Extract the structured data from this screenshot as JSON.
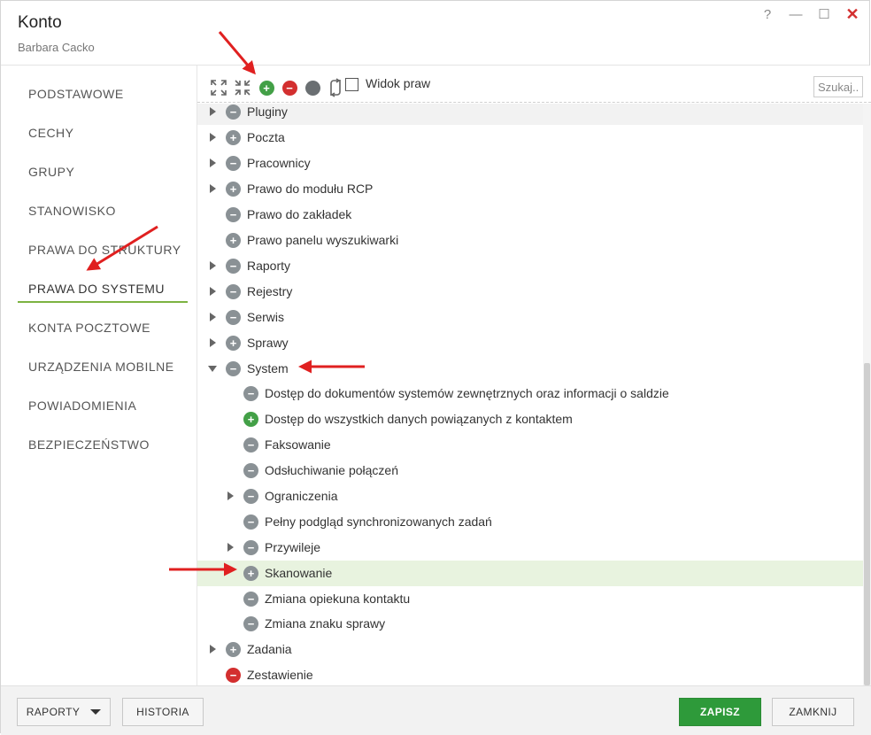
{
  "window": {
    "title": "Konto",
    "subtitle": "Barbara Cacko",
    "controls": {
      "help": "?",
      "minimize": "—",
      "maximize": "☐",
      "close": "✕"
    }
  },
  "sidebar": {
    "items": [
      {
        "label": "PODSTAWOWE",
        "active": false
      },
      {
        "label": "CECHY",
        "active": false
      },
      {
        "label": "GRUPY",
        "active": false
      },
      {
        "label": "STANOWISKO",
        "active": false
      },
      {
        "label": "PRAWA DO STRUKTURY",
        "active": false
      },
      {
        "label": "PRAWA DO SYSTEMU",
        "active": true
      },
      {
        "label": "KONTA POCZTOWE",
        "active": false
      },
      {
        "label": "URZĄDZENIA MOBILNE",
        "active": false
      },
      {
        "label": "POWIADOMIENIA",
        "active": false
      },
      {
        "label": "BEZPIECZEŃSTWO",
        "active": false
      }
    ]
  },
  "toolbar": {
    "expand_icon": "expand-all-icon",
    "collapse_icon": "collapse-all-icon",
    "grant_icon": "plus-circle-icon",
    "deny_icon": "minus-circle-icon",
    "inherit_icon": "gray-circle-icon",
    "toggle_icon": "swap-icon",
    "widok_label": "Widok praw",
    "search_placeholder": "Szukaj..."
  },
  "tree": [
    {
      "label": "Pluginy",
      "state": "gray-minus",
      "expander": "right",
      "level": 0
    },
    {
      "label": "Poczta",
      "state": "gray-plus",
      "expander": "right",
      "level": 0
    },
    {
      "label": "Pracownicy",
      "state": "gray-minus",
      "expander": "right",
      "level": 0
    },
    {
      "label": "Prawo do modułu RCP",
      "state": "gray-plus",
      "expander": "right",
      "level": 0
    },
    {
      "label": "Prawo do zakładek",
      "state": "gray-minus",
      "expander": "",
      "level": 0
    },
    {
      "label": "Prawo panelu wyszukiwarki",
      "state": "gray-plus",
      "expander": "",
      "level": 0
    },
    {
      "label": "Raporty",
      "state": "gray-minus",
      "expander": "right",
      "level": 0
    },
    {
      "label": "Rejestry",
      "state": "gray-minus",
      "expander": "right",
      "level": 0
    },
    {
      "label": "Serwis",
      "state": "gray-minus",
      "expander": "right",
      "level": 0
    },
    {
      "label": "Sprawy",
      "state": "gray-plus",
      "expander": "right",
      "level": 0
    },
    {
      "label": "System",
      "state": "gray-minus",
      "expander": "down",
      "level": 0
    },
    {
      "label": "Dostęp do dokumentów systemów zewnętrznych oraz informacji o saldzie",
      "state": "gray-minus",
      "expander": "",
      "level": 1
    },
    {
      "label": "Dostęp do wszystkich danych powiązanych z kontaktem",
      "state": "green-plus",
      "expander": "",
      "level": 1
    },
    {
      "label": "Faksowanie",
      "state": "gray-minus",
      "expander": "",
      "level": 1
    },
    {
      "label": "Odsłuchiwanie połączeń",
      "state": "gray-minus",
      "expander": "",
      "level": 1
    },
    {
      "label": "Ograniczenia",
      "state": "gray-minus",
      "expander": "right",
      "level": 1
    },
    {
      "label": "Pełny podgląd synchronizowanych zadań",
      "state": "gray-minus",
      "expander": "",
      "level": 1
    },
    {
      "label": "Przywileje",
      "state": "gray-minus",
      "expander": "right",
      "level": 1
    },
    {
      "label": "Skanowanie",
      "state": "gray-plus",
      "expander": "",
      "level": 1
    },
    {
      "label": "Zmiana opiekuna kontaktu",
      "state": "gray-minus",
      "expander": "",
      "level": 1
    },
    {
      "label": "Zmiana znaku sprawy",
      "state": "gray-minus",
      "expander": "",
      "level": 1
    },
    {
      "label": "Zadania",
      "state": "gray-plus",
      "expander": "right",
      "level": 0
    },
    {
      "label": "Zestawienie",
      "state": "red-minus",
      "expander": "",
      "level": 0
    }
  ],
  "footer": {
    "raporty_label": "RAPORTY",
    "historia_label": "HISTORIA",
    "zapisz_label": "ZAPISZ",
    "zamknij_label": "ZAMKNIJ"
  },
  "colors": {
    "accent_green": "#43a047",
    "deny_red": "#d32f2f",
    "neutral_gray": "#8a9195",
    "active_underline": "#7cb342",
    "selected_row": "#e8f3df",
    "annotation_arrow": "#e02020"
  }
}
